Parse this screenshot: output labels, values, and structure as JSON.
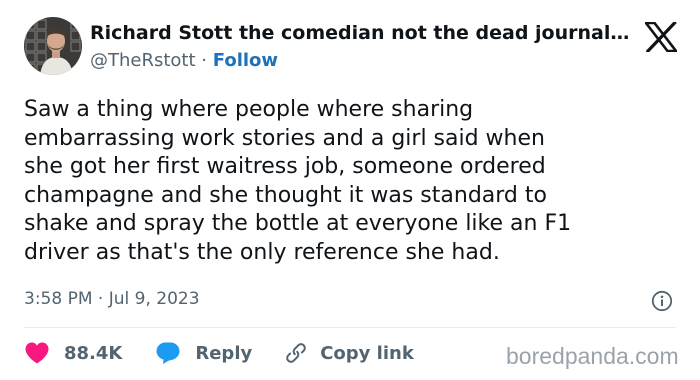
{
  "author": {
    "display_name": "Richard Stott the comedian not the dead journal...",
    "handle": "@TheRstott",
    "separator": "·",
    "follow_label": "Follow"
  },
  "tweet": {
    "lines": [
      "Saw a thing where people where sharing",
      "embarrassing work stories and a girl said when",
      "she got her first waitress job, someone ordered",
      "champagne and she thought it was standard to",
      "shake and spray the bottle at everyone like an F1",
      "driver as that's the only reference she had."
    ],
    "timestamp": "3:58 PM · Jul 9, 2023"
  },
  "actions": {
    "likes_count": "88.4K",
    "reply_label": "Reply",
    "copy_link_label": "Copy link"
  },
  "watermark": "boredpanda.com",
  "colors": {
    "like_heart": "#f91880",
    "reply_bubble": "#1d9bf0",
    "follow_link": "#1d72b8",
    "secondary_text": "#536471"
  },
  "icons": {
    "platform_logo": "x-logo-icon",
    "like": "heart-icon",
    "reply": "speech-bubble-icon",
    "copy": "link-icon",
    "info": "info-icon"
  }
}
